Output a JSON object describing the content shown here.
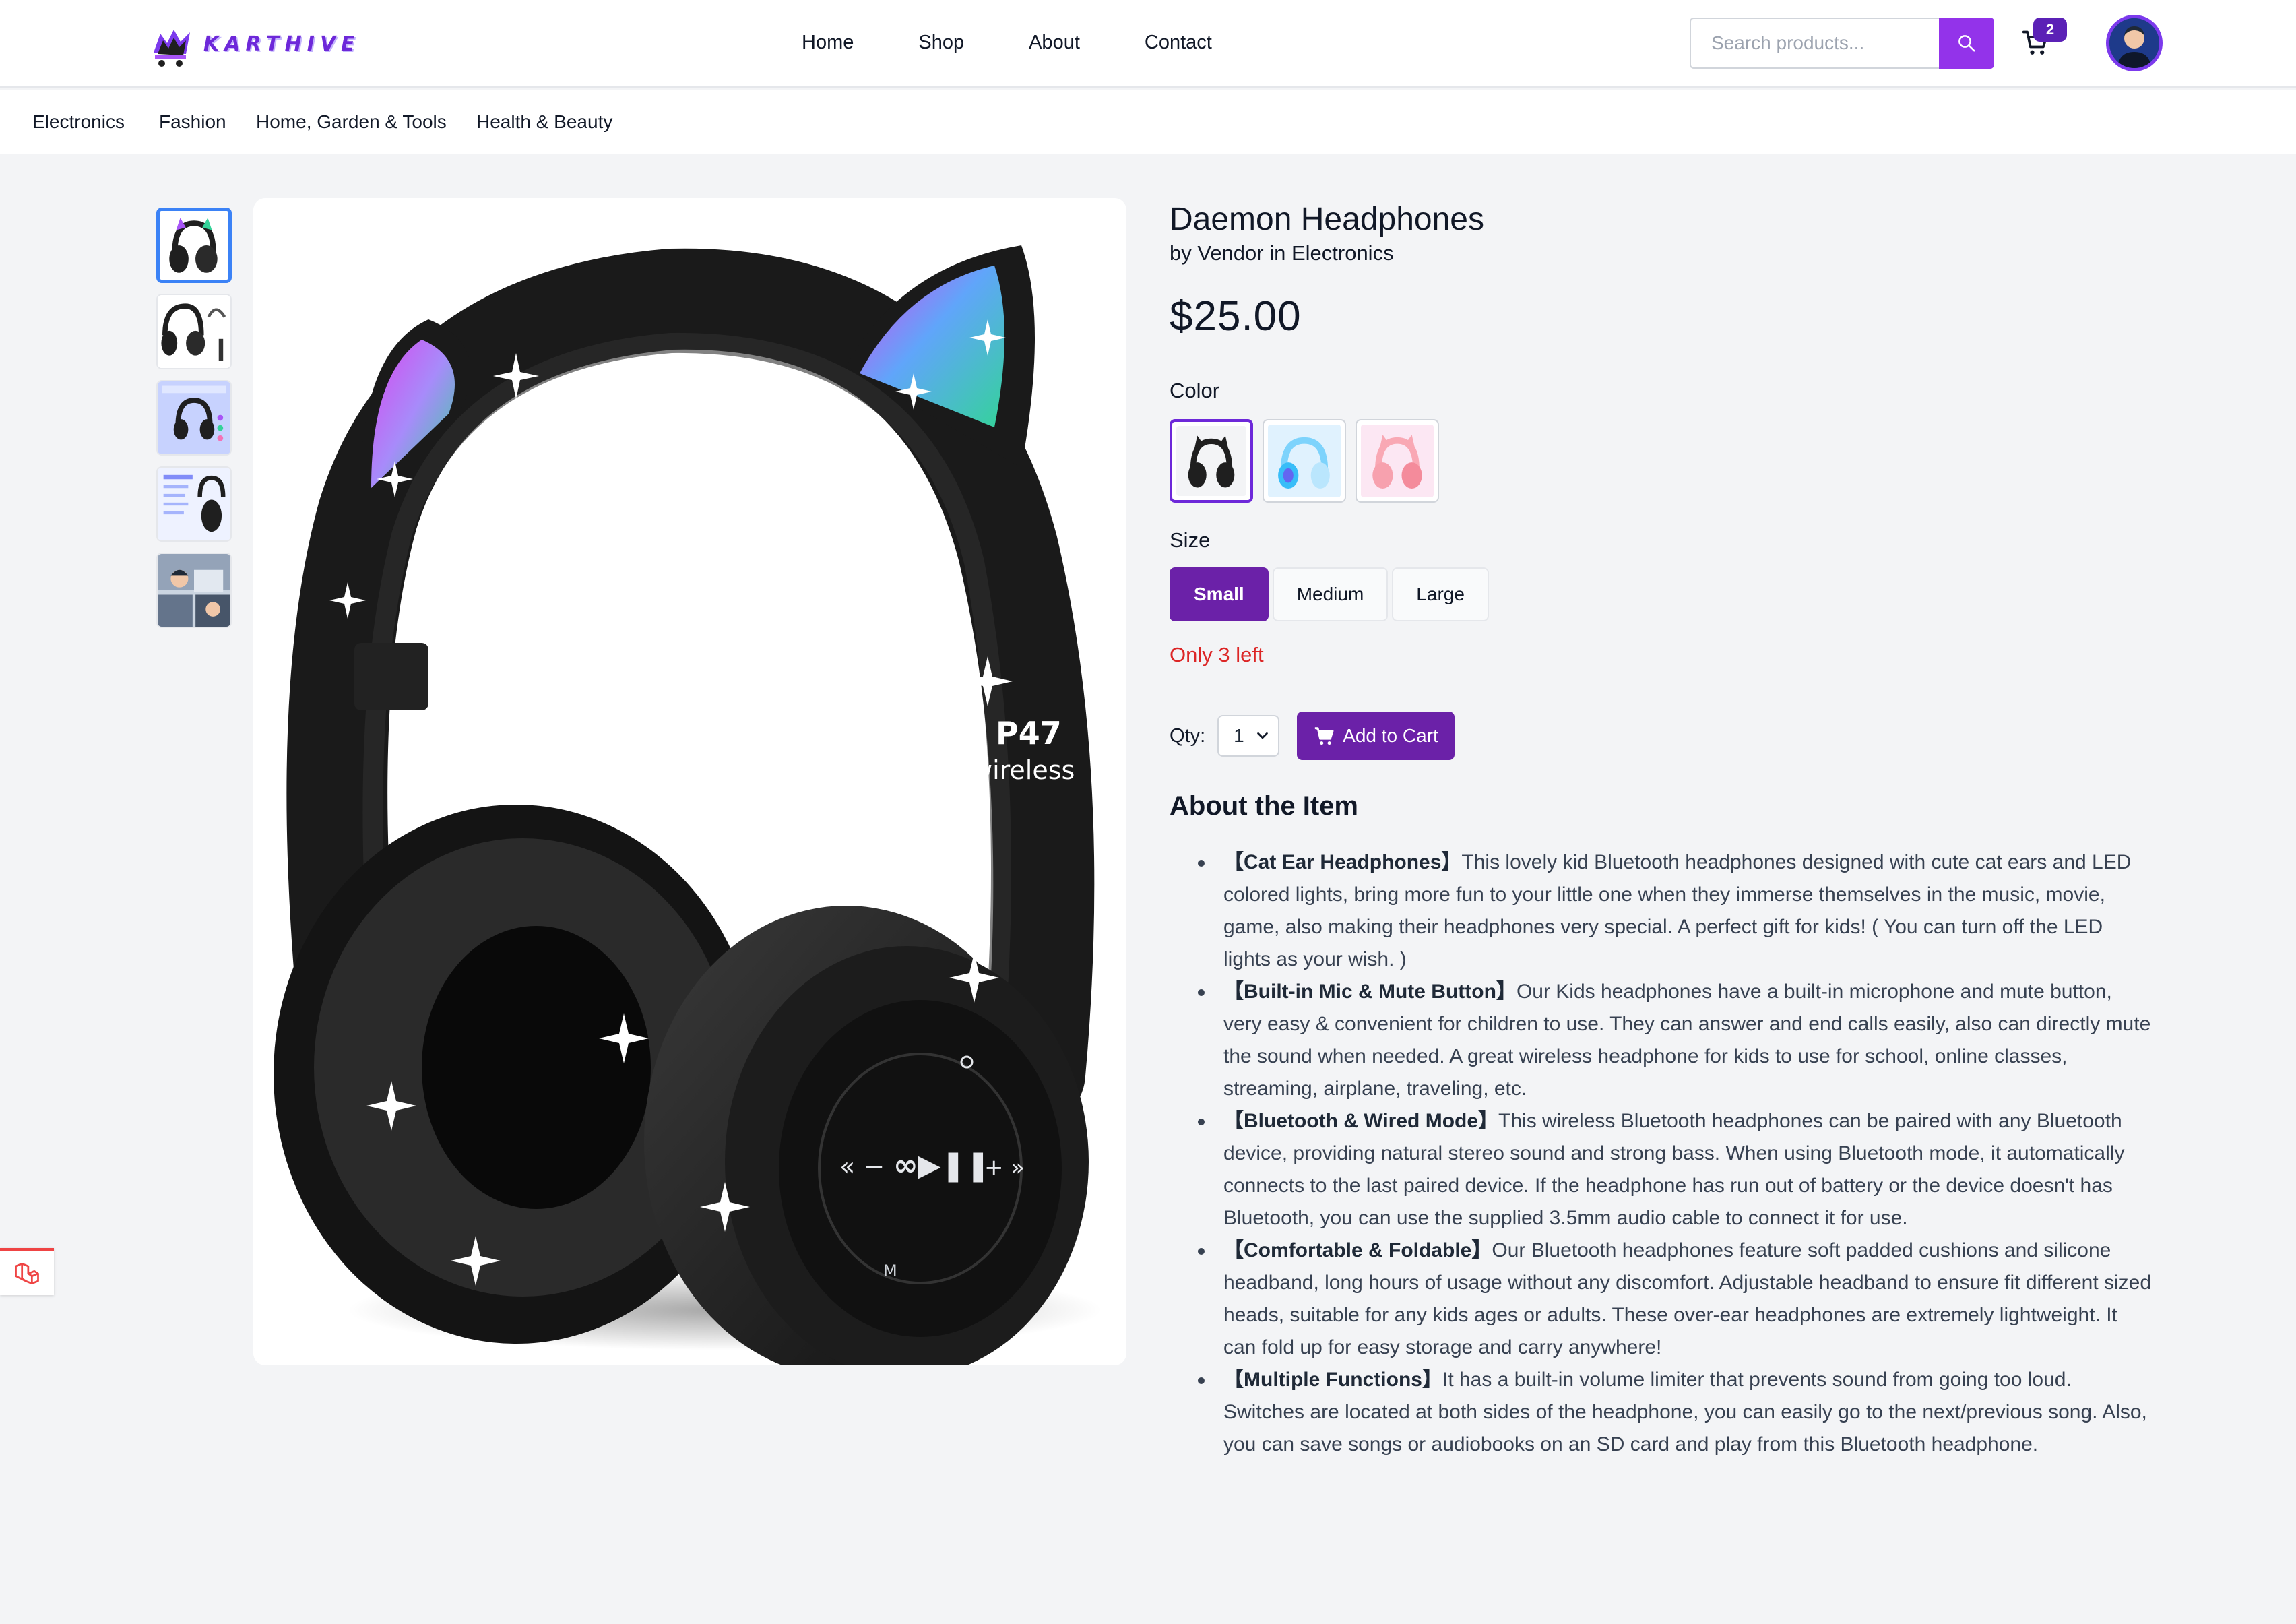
{
  "brand": {
    "name": "KARTHIVE"
  },
  "nav": {
    "home": "Home",
    "shop": "Shop",
    "about": "About",
    "contact": "Contact"
  },
  "search": {
    "placeholder": "Search products...",
    "value": ""
  },
  "cart": {
    "count": "2"
  },
  "categories": [
    "Electronics",
    "Fashion",
    "Home, Garden & Tools",
    "Health & Beauty"
  ],
  "product": {
    "title": "Daemon Headphones",
    "byline": "by Vendor in Electronics",
    "price": "$25.00",
    "color_label": "Color",
    "colors": [
      {
        "name": "black",
        "hex": "#1f1f1f",
        "selected": true
      },
      {
        "name": "blue",
        "hex": "#7dd3fc",
        "selected": false
      },
      {
        "name": "pink",
        "hex": "#f9a8b4",
        "selected": false
      }
    ],
    "size_label": "Size",
    "sizes": [
      "Small",
      "Medium",
      "Large"
    ],
    "selected_size": "Small",
    "stock": "Only 3 left",
    "qty_label": "Qty:",
    "qty_value": "1",
    "add_to_cart": "Add to Cart",
    "image_text": {
      "model": "P47",
      "sub": "wireless"
    }
  },
  "about": {
    "title": "About the Item",
    "items": [
      {
        "head": "【Cat Ear Headphones】",
        "text": "This lovely kid Bluetooth headphones designed with cute cat ears and LED colored lights, bring more fun to your little one when they immerse themselves in the music, movie, game, also making their headphones very special. A perfect gift for kids! ( You can turn off the LED lights as your wish. )"
      },
      {
        "head": "【Built-in Mic & Mute Button】",
        "text": "Our Kids headphones have a built-in microphone and mute button, very easy & convenient for children to use. They can answer and end calls easily, also can directly mute the sound when needed. A great wireless headphone for kids to use for school, online classes, streaming, airplane, traveling, etc."
      },
      {
        "head": "【Bluetooth & Wired Mode】",
        "text": "This wireless Bluetooth headphones can be paired with any Bluetooth device, providing natural stereo sound and strong bass. When using Bluetooth mode, it automatically connects to the last paired device. If the headphone has run out of battery or the device doesn't has Bluetooth, you can use the supplied 3.5mm audio cable to connect it for use."
      },
      {
        "head": "【Comfortable & Foldable】",
        "text": "Our Bluetooth headphones feature soft padded cushions and silicone headband, long hours of usage without any discomfort. Adjustable headband to ensure fit different sized heads, suitable for any kids ages or adults. These over-ear headphones are extremely lightweight. It can fold up for easy storage and carry anywhere!"
      },
      {
        "head": "【Multiple Functions】",
        "text": "It has a built-in volume limiter that prevents sound from going too loud. Switches are located at both sides of the headphone, you can easily go to the next/previous song. Also, you can save songs or audiobooks on an SD card and play from this Bluetooth headphone."
      }
    ]
  },
  "colors": {
    "accent": "#6b21a8",
    "search_button": "#9333ea",
    "stock_text": "#dc2626",
    "thumb_active": "#3b82f6"
  }
}
